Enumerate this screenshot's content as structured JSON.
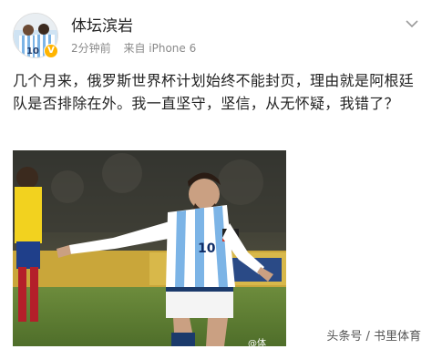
{
  "user": {
    "name": "体坛滨岩",
    "time": "2分钟前",
    "device": "来自 iPhone 6",
    "verified": true,
    "verified_color": "#ffb400"
  },
  "post": {
    "text": "几个月来，俄罗斯世界杯计划始终不能封页，理由就是阿根廷队是否排除在外。我一直坚守，坚信，从无怀疑，我错了？"
  },
  "photo": {
    "player_number": "10",
    "watermark": "@体"
  },
  "footer": {
    "source": "头条号 / 书里体育"
  },
  "colors": {
    "accent": "#ffb400",
    "meta_text": "#8a8a8a",
    "jersey_blue": "#7cb4e6"
  }
}
